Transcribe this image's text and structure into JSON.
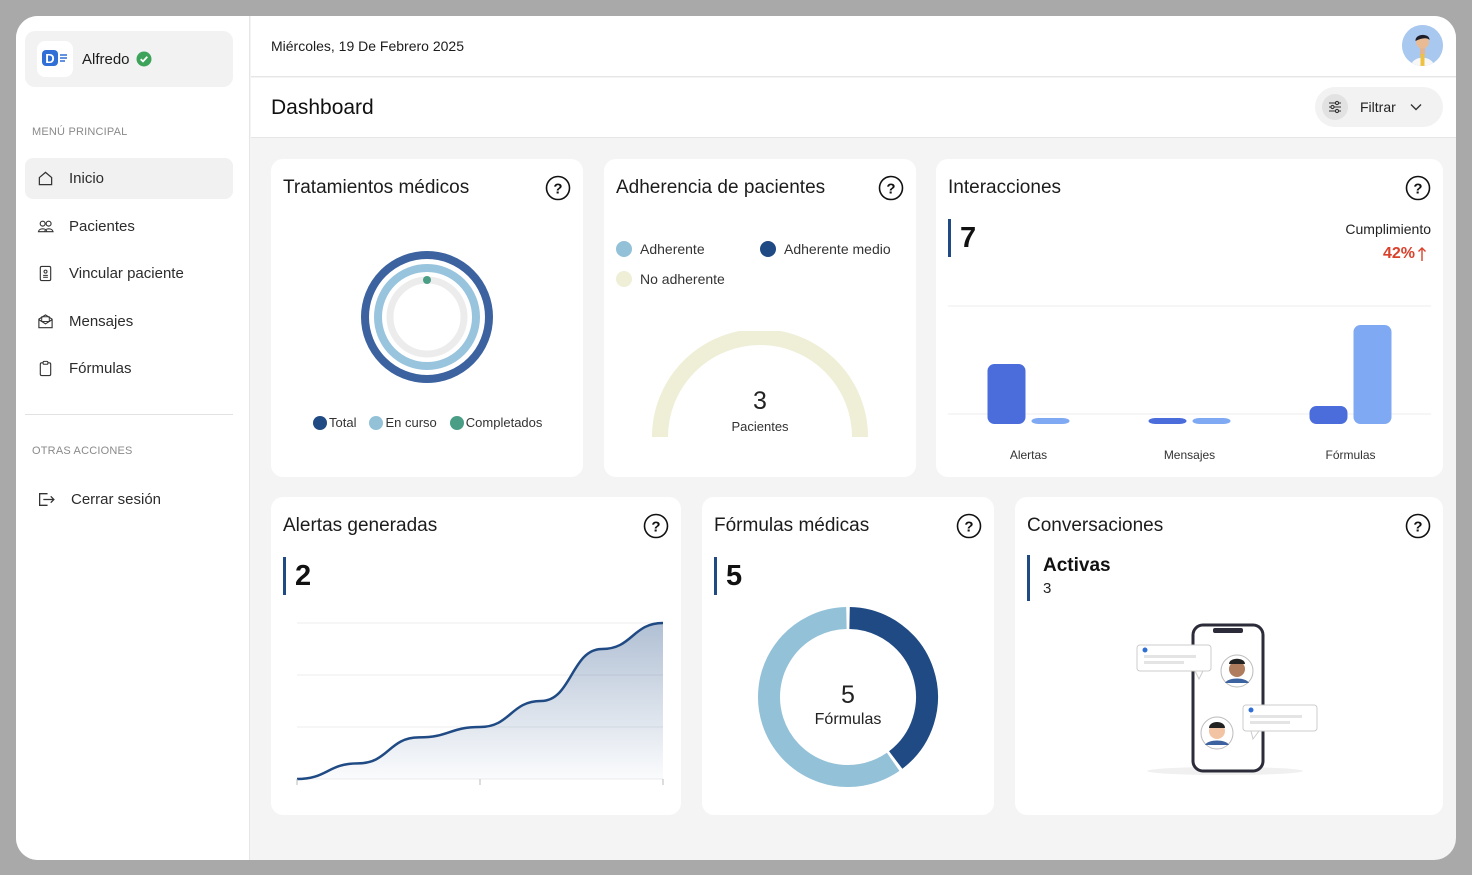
{
  "user": {
    "name": "Alfredo",
    "logo_letter": "D"
  },
  "sidebar": {
    "main_label": "MENÚ PRINCIPAL",
    "items": [
      {
        "label": "Inicio",
        "icon": "home-icon"
      },
      {
        "label": "Pacientes",
        "icon": "users-icon"
      },
      {
        "label": "Vincular paciente",
        "icon": "id-card-icon"
      },
      {
        "label": "Mensajes",
        "icon": "mail-icon"
      },
      {
        "label": "Fórmulas",
        "icon": "clipboard-icon"
      }
    ],
    "other_label": "OTRAS ACCIONES",
    "logout_label": "Cerrar sesión"
  },
  "header": {
    "date": "Miércoles, 19 De Febrero 2025"
  },
  "page": {
    "title": "Dashboard",
    "filter_label": "Filtrar"
  },
  "cards": {
    "tratamientos": {
      "title": "Tratamientos médicos",
      "legend": [
        "Total",
        "En curso",
        "Completados"
      ]
    },
    "adherencia": {
      "title": "Adherencia de pacientes",
      "legend": [
        "Adherente",
        "Adherente medio",
        "No adherente"
      ],
      "value": "3",
      "value_label": "Pacientes"
    },
    "interacciones": {
      "title": "Interacciones",
      "value": "7",
      "cumplimiento_label": "Cumplimiento",
      "cumplimiento_value": "42%",
      "categories": [
        "Alertas",
        "Mensajes",
        "Fórmulas"
      ]
    },
    "alertas": {
      "title": "Alertas generadas",
      "value": "2"
    },
    "formulas": {
      "title": "Fórmulas médicas",
      "value": "5",
      "center_value": "5",
      "center_label": "Fórmulas"
    },
    "conversaciones": {
      "title": "Conversaciones",
      "active_label": "Activas",
      "active_value": "3"
    }
  },
  "colors": {
    "navy": "#1f4a84",
    "light_blue": "#92c1d8",
    "teal": "#4a9e86",
    "cream": "#efeed6",
    "royal_blue": "#4a6ddb",
    "sky_blue": "#7fa9f3",
    "red": "#d9412b"
  },
  "chart_data": [
    {
      "type": "line",
      "title": "Alertas generadas",
      "x": [
        0,
        1,
        2,
        3,
        4,
        5,
        6
      ],
      "y": [
        1,
        1.3,
        1.8,
        2,
        2.5,
        3.5,
        4
      ],
      "ylim": [
        1,
        4
      ],
      "yticks": [
        "1",
        "2",
        "3",
        "4"
      ]
    },
    {
      "type": "bar",
      "title": "Interacciones",
      "categories": [
        "Alertas",
        "Mensajes",
        "Fórmulas"
      ],
      "series": [
        {
          "values": [
            2,
            0.2,
            0.6
          ]
        },
        {
          "values": [
            0.2,
            0.2,
            3.3
          ]
        }
      ]
    },
    {
      "type": "pie",
      "title": "Fórmulas médicas",
      "values": [
        40,
        60
      ]
    },
    {
      "type": "pie",
      "title": "Adherencia de pacientes",
      "labels": [
        "Adherente",
        "Adherente medio",
        "No adherente"
      ],
      "values": [
        0,
        0,
        3
      ]
    },
    {
      "type": "pie",
      "title": "Tratamientos médicos",
      "labels": [
        "Total",
        "En curso",
        "Completados"
      ],
      "values": [
        1,
        0.9,
        0.02
      ]
    }
  ]
}
